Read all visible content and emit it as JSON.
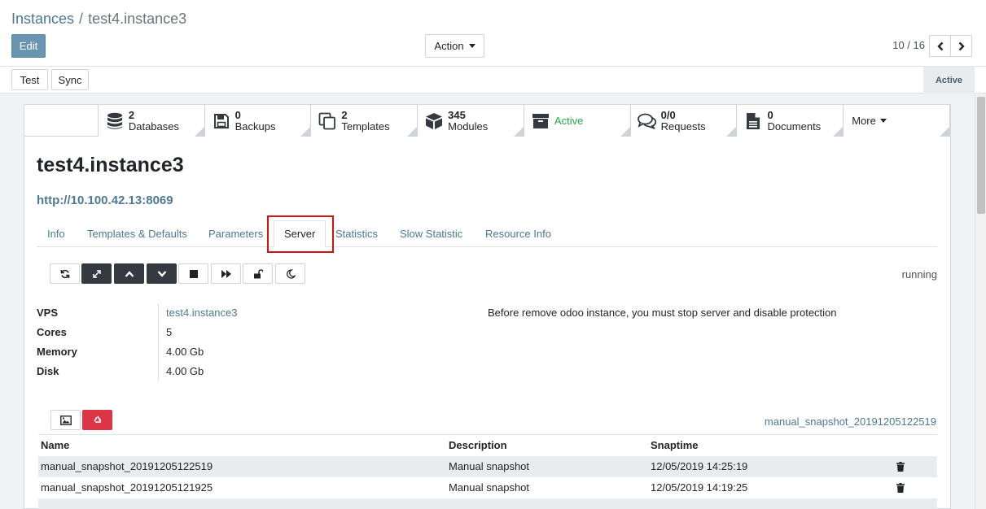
{
  "breadcrumb": {
    "parent": "Instances",
    "separator": "/",
    "current": "test4.instance3"
  },
  "control": {
    "edit_label": "Edit",
    "action_label": "Action",
    "pager": "10 / 16"
  },
  "statusbar": {
    "test_label": "Test",
    "sync_label": "Sync",
    "state": "Active"
  },
  "button_box": {
    "databases": {
      "count": "2",
      "label": "Databases",
      "icon": "database-icon"
    },
    "backups": {
      "count": "0",
      "label": "Backups",
      "icon": "floppy-disk-icon"
    },
    "templates": {
      "count": "2",
      "label": "Templates",
      "icon": "copy-icon"
    },
    "modules": {
      "count": "345",
      "label": "Modules",
      "icon": "cube-icon"
    },
    "active": {
      "label": "Active",
      "icon": "archive-icon"
    },
    "requests": {
      "count": "0/0",
      "label": "Requests",
      "icon": "comments-icon"
    },
    "documents": {
      "count": "0",
      "label": "Documents",
      "icon": "document-icon"
    },
    "more_label": "More"
  },
  "record": {
    "title": "test4.instance3",
    "url": "http://10.100.42.13:8069"
  },
  "tabs": [
    "Info",
    "Templates & Defaults",
    "Parameters",
    "Server",
    "Statistics",
    "Slow Statistic",
    "Resource Info"
  ],
  "server": {
    "status": "running",
    "fields": {
      "vps_label": "VPS",
      "vps_value": "test4.instance3",
      "cores_label": "Cores",
      "cores_value": "5",
      "memory_label": "Memory",
      "memory_value": "4.00 Gb",
      "disk_label": "Disk",
      "disk_value": "4.00 Gb"
    },
    "note": "Before remove odoo instance, you must stop server and disable protection"
  },
  "snapshots": {
    "current": "manual_snapshot_20191205122519",
    "headers": {
      "name": "Name",
      "description": "Description",
      "snaptime": "Snaptime"
    },
    "rows": [
      {
        "name": "manual_snapshot_20191205122519",
        "description": "Manual snapshot",
        "snaptime": "12/05/2019 14:25:19"
      },
      {
        "name": "manual_snapshot_20191205121925",
        "description": "Manual snapshot",
        "snaptime": "12/05/2019 14:19:25"
      }
    ]
  },
  "colors": {
    "link": "#4c7a93",
    "primary": "#6995b0",
    "success": "#28a745",
    "danger": "#dc3545",
    "highlight": "#d81010"
  }
}
